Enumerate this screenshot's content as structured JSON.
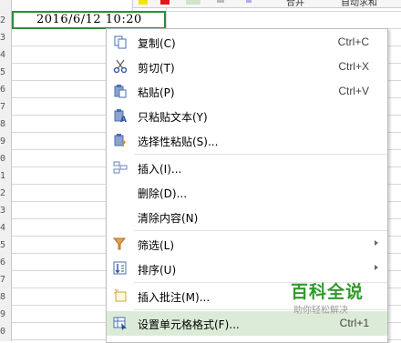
{
  "sheet": {
    "row_numbers": [
      "2",
      "3",
      "4",
      "5",
      "6",
      "7",
      "8",
      "9",
      "0",
      "1",
      "2",
      "3",
      "4",
      "5",
      "6",
      "7",
      "8",
      "9",
      "0"
    ],
    "selected_cell_value": "2016/6/12 10:20"
  },
  "toolbar": {
    "partial_labels": [
      "合并",
      "自动求和"
    ]
  },
  "context_menu": {
    "items": [
      {
        "label": "复制(C)",
        "shortcut": "Ctrl+C",
        "icon": "copy-icon"
      },
      {
        "label": "剪切(T)",
        "shortcut": "Ctrl+X",
        "icon": "scissors-icon"
      },
      {
        "label": "粘贴(P)",
        "shortcut": "Ctrl+V",
        "icon": "paste-icon"
      },
      {
        "label": "只粘贴文本(Y)",
        "shortcut": "",
        "icon": "paste-text-icon"
      },
      {
        "label": "选择性粘贴(S)...",
        "shortcut": "",
        "icon": "paste-special-icon"
      },
      {
        "label": "插入(I)...",
        "shortcut": "",
        "icon": "insert-icon"
      },
      {
        "label": "删除(D)...",
        "shortcut": "",
        "icon": ""
      },
      {
        "label": "清除内容(N)",
        "shortcut": "",
        "icon": ""
      },
      {
        "label": "筛选(L)",
        "shortcut": "",
        "icon": "filter-icon",
        "submenu": true
      },
      {
        "label": "排序(U)",
        "shortcut": "",
        "icon": "sort-icon",
        "submenu": true
      },
      {
        "label": "插入批注(M)...",
        "shortcut": "",
        "icon": "comment-icon"
      },
      {
        "label": "设置单元格格式(F)...",
        "shortcut": "Ctrl+1",
        "icon": "format-cells-icon",
        "highlighted": true
      }
    ]
  },
  "watermark": {
    "title": "百科全说",
    "subtitle": "助你轻松解决"
  },
  "colors": {
    "selection_border": "#2e8b3a",
    "menu_highlight": "#dcebd7",
    "watermark_green": "#2f9a2a"
  }
}
